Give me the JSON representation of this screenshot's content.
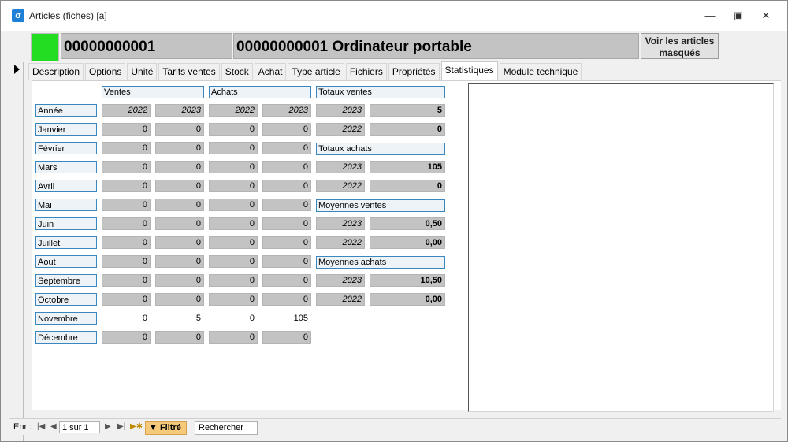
{
  "window": {
    "title": "Articles (fiches) [a]"
  },
  "header": {
    "code": "00000000001",
    "designation": "00000000001 Ordinateur portable",
    "masked_button": "Voir les articles masqués"
  },
  "tabs": [
    "Description",
    "Options",
    "Unité",
    "Tarifs ventes",
    "Stock",
    "Achat",
    "Type article",
    "Fichiers",
    "Propriétés",
    "Statistiques",
    "Module technique"
  ],
  "stats": {
    "ventes_label": "Ventes",
    "achats_label": "Achats",
    "year_row_label": "Année",
    "ventes_years": [
      "2022",
      "2023"
    ],
    "achats_years": [
      "2022",
      "2023"
    ],
    "months": [
      "Janvier",
      "Février",
      "Mars",
      "Avril",
      "Mai",
      "Juin",
      "Juillet",
      "Aout",
      "Septembre",
      "Octobre",
      "Novembre",
      "Décembre"
    ],
    "ventes_2022": [
      "0",
      "0",
      "0",
      "0",
      "0",
      "0",
      "0",
      "0",
      "0",
      "0",
      "0",
      "0"
    ],
    "ventes_2023": [
      "0",
      "0",
      "0",
      "0",
      "0",
      "0",
      "0",
      "0",
      "0",
      "0",
      "5",
      "0"
    ],
    "achats_2022": [
      "0",
      "0",
      "0",
      "0",
      "0",
      "0",
      "0",
      "0",
      "0",
      "0",
      "0",
      "0"
    ],
    "achats_2023": [
      "0",
      "0",
      "0",
      "0",
      "0",
      "0",
      "0",
      "0",
      "0",
      "0",
      "105",
      "0"
    ]
  },
  "totals": {
    "totaux_ventes_label": "Totaux ventes",
    "totaux_ventes": [
      {
        "year": "2023",
        "value": "5"
      },
      {
        "year": "2022",
        "value": "0"
      }
    ],
    "totaux_achats_label": "Totaux achats",
    "totaux_achats": [
      {
        "year": "2023",
        "value": "105"
      },
      {
        "year": "2022",
        "value": "0"
      }
    ],
    "moyennes_ventes_label": "Moyennes ventes",
    "moyennes_ventes": [
      {
        "year": "2023",
        "value": "0,50"
      },
      {
        "year": "2022",
        "value": "0,00"
      }
    ],
    "moyennes_achats_label": "Moyennes achats",
    "moyennes_achats": [
      {
        "year": "2023",
        "value": "10,50"
      },
      {
        "year": "2022",
        "value": "0,00"
      }
    ]
  },
  "statusbar": {
    "record_label": "Enr :",
    "record_value": "1 sur 1",
    "filter_label": "Filtré",
    "search_label": "Rechercher"
  },
  "colors": {
    "status_green": "#22dd22",
    "field_gray": "#c3c3c3",
    "label_border": "#3a87c0"
  }
}
